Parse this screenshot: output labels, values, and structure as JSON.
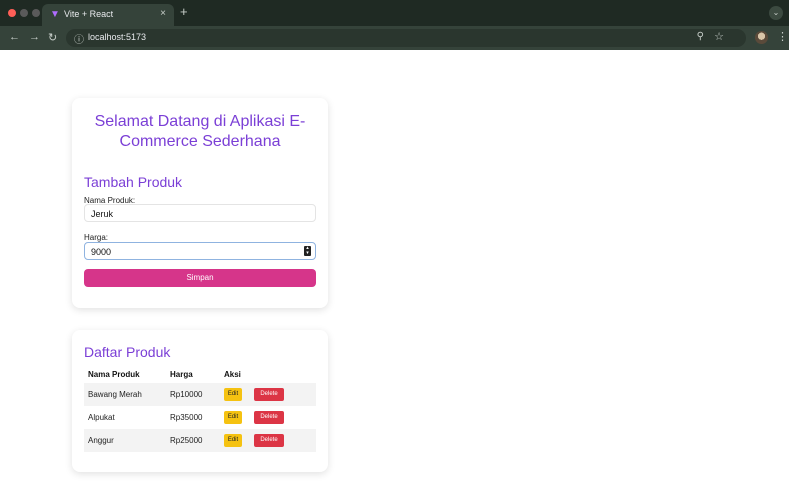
{
  "browser": {
    "tab_title": "Vite + React",
    "tab_close": "×",
    "new_tab": "+",
    "url": "localhost:5173"
  },
  "form_card": {
    "welcome_line1": "Selamat Datang di Aplikasi E-",
    "welcome_line2": "Commerce Sederhana",
    "section_title": "Tambah Produk",
    "name_label": "Nama Produk:",
    "name_value": "Jeruk",
    "price_label": "Harga:",
    "price_value": "9000",
    "save_label": "Simpan"
  },
  "list_card": {
    "section_title": "Daftar Produk",
    "headers": [
      "Nama Produk",
      "Harga",
      "Aksi"
    ],
    "edit_label": "Edit",
    "delete_label": "Delete",
    "rows": [
      {
        "name": "Bawang Merah",
        "price": "Rp10000"
      },
      {
        "name": "Alpukat",
        "price": "Rp35000"
      },
      {
        "name": "Anggur",
        "price": "Rp25000"
      }
    ]
  },
  "colors": {
    "accent_purple": "#7b3fd6",
    "save_pink": "#d6358a",
    "edit_yellow": "#f5c211",
    "delete_red": "#dc3545"
  },
  "icons": [
    "vite-icon",
    "back-icon",
    "forward-icon",
    "reload-icon",
    "site-info-icon",
    "zoom-icon",
    "star-icon",
    "avatar",
    "kebab-menu-icon",
    "tab-menu-icon"
  ]
}
